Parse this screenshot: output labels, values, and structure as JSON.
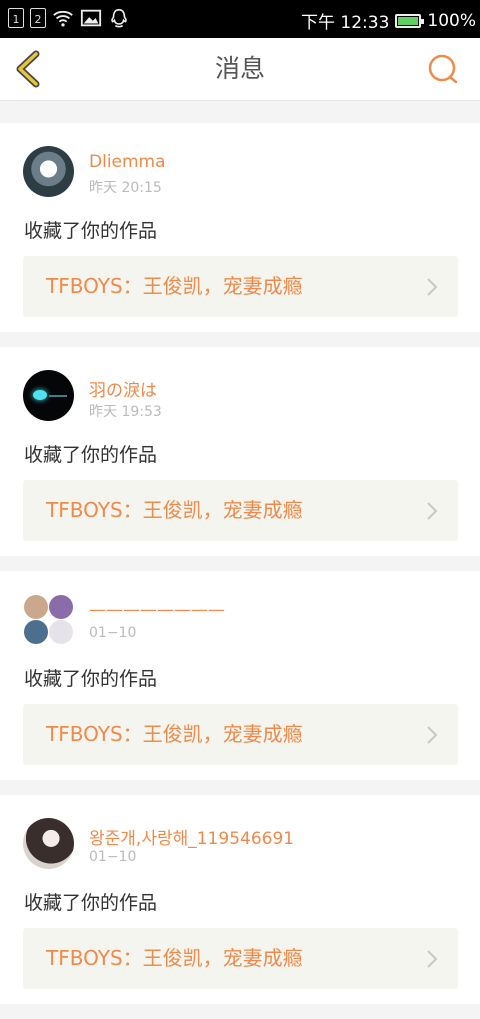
{
  "status_bar": {
    "sim1": "1",
    "sim2": "2",
    "time": "下午 12:33",
    "battery": "100%",
    "battery_level": 1.0,
    "icons": [
      "sim1-icon",
      "sim2-icon",
      "wifi-icon",
      "image-icon",
      "qq-icon",
      "battery-icon"
    ]
  },
  "nav": {
    "title": "消息",
    "back_icon": "back-chevron-icon",
    "search_icon": "search-icon",
    "accent_color": "#f08a4b",
    "back_color": "#e9c43a"
  },
  "messages": [
    {
      "username": "Dliemma",
      "time": "昨天 20:15",
      "action": "收藏了你的作品",
      "work_title": "TFBOYS：王俊凯，宠妻成瘾"
    },
    {
      "username": "羽の淚は",
      "time": "昨天 19:53",
      "action": "收藏了你的作品",
      "work_title": "TFBOYS：王俊凯，宠妻成瘾"
    },
    {
      "username": "————————",
      "time": "01−10",
      "action": "收藏了你的作品",
      "work_title": "TFBOYS：王俊凯，宠妻成瘾"
    },
    {
      "username": "왕준개,사랑해_119546691",
      "time": "01−10",
      "action": "收藏了你的作品",
      "work_title": "TFBOYS：王俊凯，宠妻成瘾"
    }
  ]
}
